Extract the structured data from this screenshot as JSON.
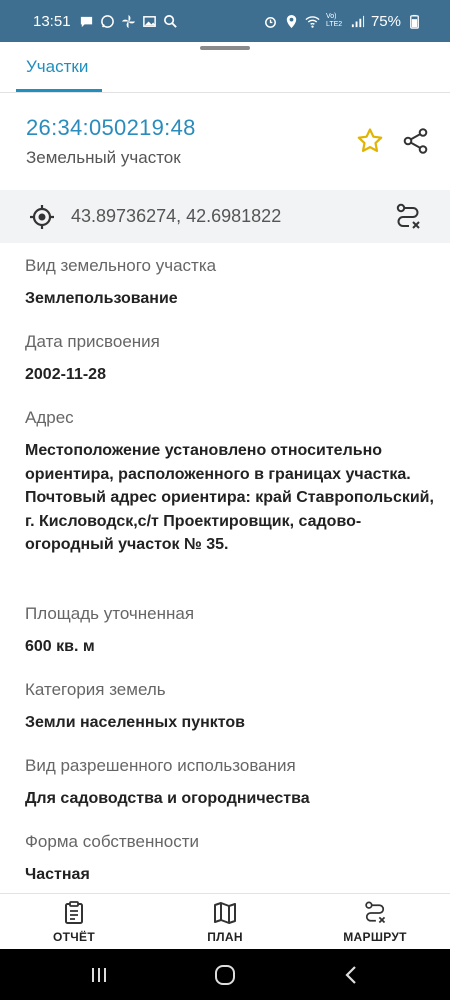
{
  "status_bar": {
    "time": "13:51",
    "battery": "75%",
    "network_label": "Vo) LTE2"
  },
  "tabs": [
    {
      "label": "Участки"
    }
  ],
  "header": {
    "cadastral_number": "26:34:050219:48",
    "object_type": "Земельный участок"
  },
  "coordinates": {
    "text": "43.89736274, 42.6981822"
  },
  "fields": [
    {
      "label": "Вид земельного участка",
      "value": "Землепользование"
    },
    {
      "label": "Дата присвоения",
      "value": "2002-11-28"
    },
    {
      "label": "Адрес",
      "value": "Местоположение установлено относительно ориентира, расположенного в границах участка. Почтовый адрес ориентира: край Ставропольский, г. Кисловодск,с/т Проектировщик, садово-огородный участок № 35."
    },
    {
      "label": "Площадь уточненная",
      "value": "600 кв. м"
    },
    {
      "label": "Категория земель",
      "value": "Земли населенных пунктов"
    },
    {
      "label": "Вид разрешенного использования",
      "value": "Для садоводства и огородничества"
    },
    {
      "label": "Форма собственности",
      "value": "Частная"
    }
  ],
  "bottom_nav": [
    {
      "label": "ОТЧЁТ",
      "icon": "report-icon"
    },
    {
      "label": "ПЛАН",
      "icon": "map-icon"
    },
    {
      "label": "МАРШРУТ",
      "icon": "route-icon"
    }
  ],
  "colors": {
    "accent": "#1f8fbf",
    "status_bar": "#3e6f90",
    "star": "#e0b400"
  }
}
